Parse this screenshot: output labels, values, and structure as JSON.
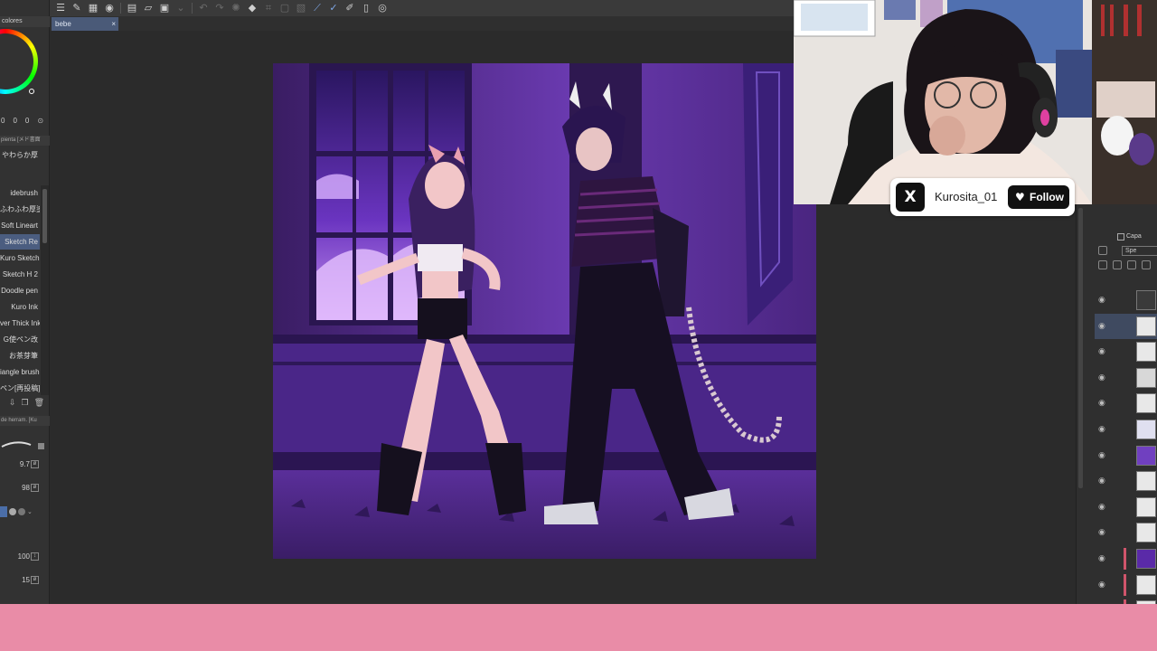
{
  "toolbar": {
    "icons": [
      "menu-icon",
      "new-icon",
      "save-icon",
      "camera-icon",
      "layer-icon",
      "folder-icon",
      "export-icon",
      "chevron-icon",
      "undo-icon",
      "redo-icon",
      "loading-icon",
      "fill-icon",
      "transform-icon",
      "selection-icon",
      "deselect-icon",
      "ruler-icon",
      "pen-icon",
      "pencil-icon",
      "brush-icon",
      "clipboard-icon",
      "search-icon"
    ]
  },
  "document": {
    "tab_name": "bebe",
    "close_glyph": "×"
  },
  "color_panel": {
    "title": "colores",
    "main_color": "#11b0a8",
    "values": [
      "0",
      "0",
      "0"
    ]
  },
  "brush_panel": {
    "tool_header": "pienta [メド書面",
    "tool_name": "やわらか厚",
    "brushes": [
      {
        "label": "idebrush",
        "selected": false
      },
      {
        "label": "ふわふわ厚塗り",
        "selected": false
      },
      {
        "label": "Soft Lineart",
        "selected": false
      },
      {
        "label": "Sketch Re",
        "selected": true
      },
      {
        "label": "Kuro Sketch",
        "selected": false
      },
      {
        "label": "Sketch H 2",
        "selected": false
      },
      {
        "label": "Doodle pen",
        "selected": false
      },
      {
        "label": "Kuro Ink",
        "selected": false
      },
      {
        "label": "ver Thick Ink",
        "selected": false
      },
      {
        "label": "G使ペン改",
        "selected": false
      },
      {
        "label": "お茶芽筆",
        "selected": false
      },
      {
        "label": "iangle brush",
        "selected": false
      },
      {
        "label": "ペン[再投稿]",
        "selected": false
      }
    ]
  },
  "tool_property": {
    "header": "de herram. [Ku",
    "size": "9.7",
    "opacity": "98",
    "value3": "100",
    "value4": "15"
  },
  "layer_panel": {
    "title": "Capa",
    "blend": "Spe",
    "layer_count": 13,
    "selected_index": 1
  },
  "social": {
    "platform_icon": "x-logo-icon",
    "logo_glyph": "X",
    "handle": "Kurosita_01",
    "heart": "♥",
    "follow_label": "Follow"
  },
  "colors": {
    "bottom_band": "#e98ca7",
    "artwork_base": "#3d2266",
    "selection_blue": "#4b5d80"
  }
}
